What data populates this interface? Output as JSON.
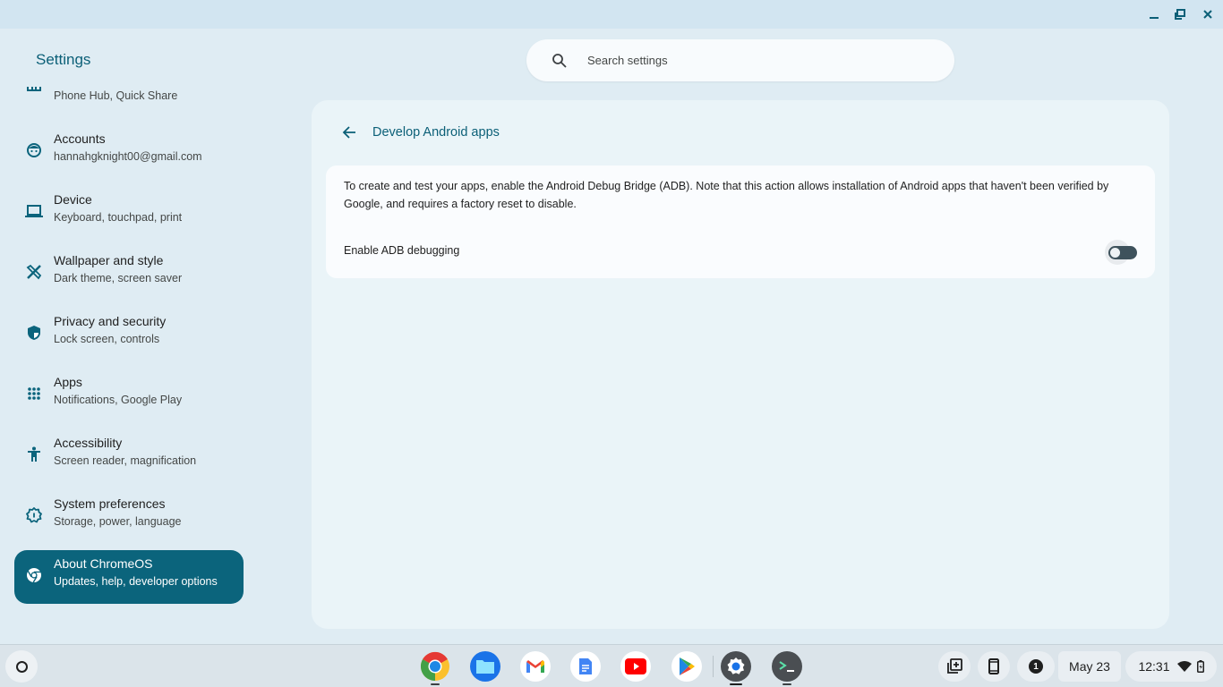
{
  "window": {
    "controls": {
      "minimize_icon": "minimize-icon",
      "restore_icon": "restore-icon",
      "close_icon": "close-icon"
    }
  },
  "header": {
    "app_title": "Settings",
    "search": {
      "placeholder": "Search settings",
      "value": "",
      "icon": "search-icon"
    }
  },
  "sidebar": {
    "items": [
      {
        "id": "connected-devices",
        "title": "",
        "subtitle": "Phone Hub, Quick Share",
        "icon": "connected-devices-icon",
        "active": false
      },
      {
        "id": "accounts",
        "title": "Accounts",
        "subtitle": "hannahgknight00@gmail.com",
        "icon": "account-face-icon",
        "active": false
      },
      {
        "id": "device",
        "title": "Device",
        "subtitle": "Keyboard, touchpad, print",
        "icon": "laptop-icon",
        "active": false
      },
      {
        "id": "wallpaper",
        "title": "Wallpaper and style",
        "subtitle": "Dark theme, screen saver",
        "icon": "palette-brush-icon",
        "active": false
      },
      {
        "id": "privacy",
        "title": "Privacy and security",
        "subtitle": "Lock screen, controls",
        "icon": "shield-icon",
        "active": false
      },
      {
        "id": "apps",
        "title": "Apps",
        "subtitle": "Notifications, Google Play",
        "icon": "apps-grid-icon",
        "active": false
      },
      {
        "id": "accessibility",
        "title": "Accessibility",
        "subtitle": "Screen reader, magnification",
        "icon": "accessibility-icon",
        "active": false
      },
      {
        "id": "system-preferences",
        "title": "System preferences",
        "subtitle": "Storage, power, language",
        "icon": "gear-icon",
        "active": false
      },
      {
        "id": "about",
        "title": "About ChromeOS",
        "subtitle": "Updates, help, developer options",
        "icon": "chrome-icon",
        "active": true
      }
    ]
  },
  "main": {
    "page_title": "Develop Android apps",
    "back_icon": "back-arrow-icon",
    "description": "To create and test your apps, enable the Android Debug Bridge (ADB). Note that this action allows installation of Android apps that haven't been verified by Google, and requires a factory reset to disable.",
    "adb_toggle": {
      "label": "Enable ADB debugging",
      "checked": false
    }
  },
  "shelf": {
    "launcher_icon": "launcher-icon",
    "apps": [
      {
        "name": "Chrome",
        "icon": "chrome-browser-icon",
        "running": true
      },
      {
        "name": "Files",
        "icon": "files-icon",
        "running": false
      },
      {
        "name": "Gmail",
        "icon": "gmail-icon",
        "running": false
      },
      {
        "name": "Docs",
        "icon": "docs-icon",
        "running": false
      },
      {
        "name": "YouTube",
        "icon": "youtube-icon",
        "running": false
      },
      {
        "name": "Play Store",
        "icon": "play-store-icon",
        "running": false
      },
      {
        "name": "Settings",
        "icon": "settings-app-icon",
        "running": true,
        "focused": true
      },
      {
        "name": "Terminal",
        "icon": "terminal-icon",
        "running": true
      }
    ],
    "tray": {
      "holding_space_icon": "holding-space-icon",
      "phone_hub_icon": "phone-icon",
      "notification_count": "1",
      "date": "May 23",
      "time": "12:31",
      "wifi_icon": "wifi-icon",
      "battery_icon": "battery-charging-icon"
    }
  },
  "colors": {
    "accent": "#0b647c",
    "title_teal": "#0b5f77",
    "background": "#dfecf3",
    "panel": "#eaf4f8",
    "card": "#fafcfe",
    "toggle_track_off": "#3e525c"
  }
}
